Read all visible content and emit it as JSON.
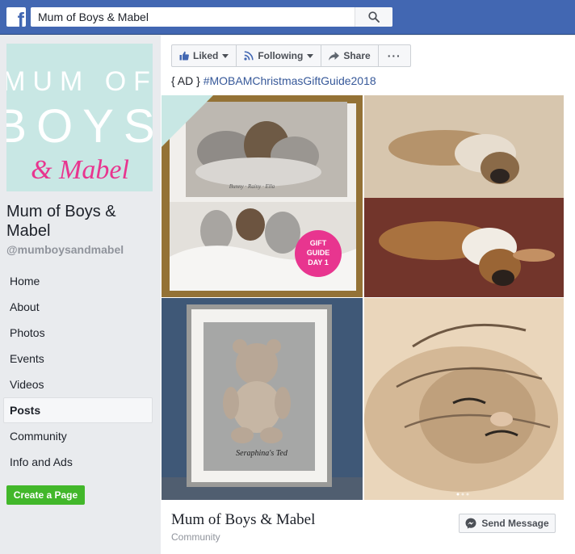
{
  "topbar": {
    "logo_letter": "f",
    "search_value": "Mum of Boys & Mabel"
  },
  "sidebar": {
    "cover": {
      "line1": "MUM OF",
      "line2": "BOYS",
      "line3": "& Mabel"
    },
    "page_name": "Mum of Boys & Mabel",
    "handle": "@mumboysandmabel",
    "nav": [
      "Home",
      "About",
      "Photos",
      "Events",
      "Videos",
      "Posts",
      "Community",
      "Info and Ads"
    ],
    "active_nav": "Posts",
    "create_page_label": "Create a Page"
  },
  "post": {
    "actions": {
      "liked": "Liked",
      "following": "Following",
      "share": "Share",
      "more": "···"
    },
    "text_prefix": "{ AD } ",
    "hashtag": "#MOBAMChristmasGiftGuide2018",
    "photos": {
      "p1_badge_line1": "GIFT",
      "p1_badge_line2": "GUIDE",
      "p1_badge_line3": "DAY 1",
      "p1_caption": "Bunny · Rainy · Ella",
      "p3_caption": "Seraphina's Ted"
    },
    "footer": {
      "page_name": "Mum of Boys & Mabel",
      "category": "Community",
      "send_message": "Send Message"
    }
  },
  "colors": {
    "facebook_blue": "#4267b2",
    "link_blue": "#365899",
    "create_green": "#42b72a",
    "cover_bg": "#c8e7e4",
    "cover_pink": "#e8358f"
  }
}
